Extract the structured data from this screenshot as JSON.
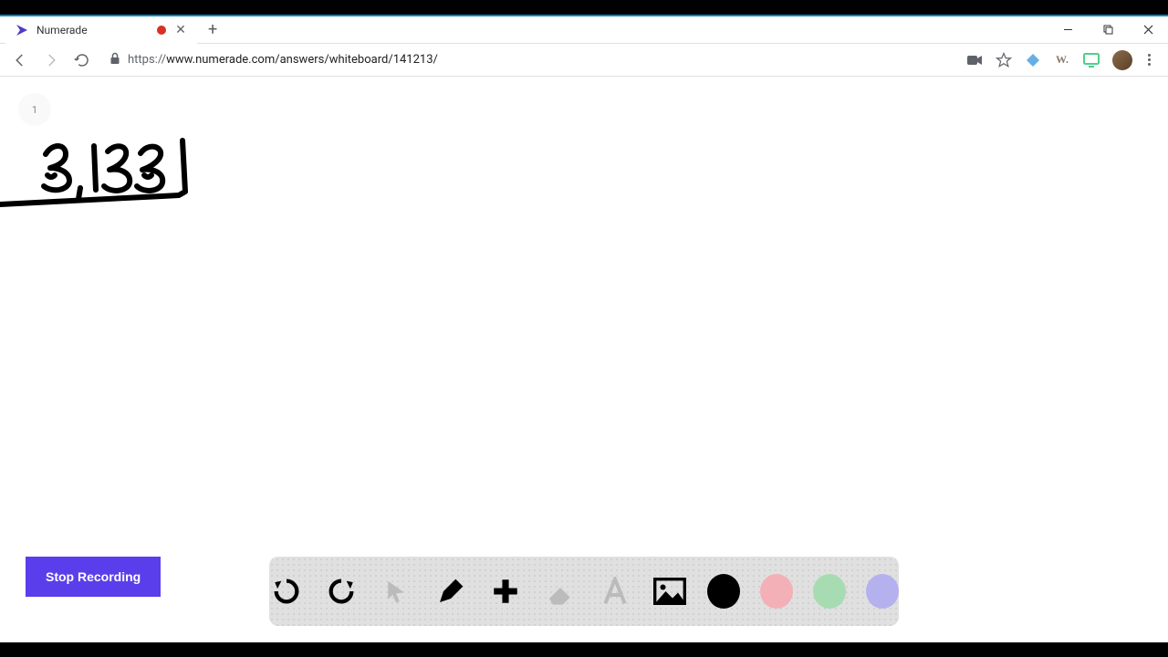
{
  "tab": {
    "title": "Numerade"
  },
  "address": {
    "prefix": "https://",
    "host_path": "www.numerade.com/answers/whiteboard/141213/"
  },
  "page_badge": "1",
  "stop_recording_label": "Stop Recording",
  "colors": {
    "black": "#000000",
    "pink": "#f3b0b6",
    "green": "#a7dcb2",
    "purple": "#b5b0ee"
  }
}
